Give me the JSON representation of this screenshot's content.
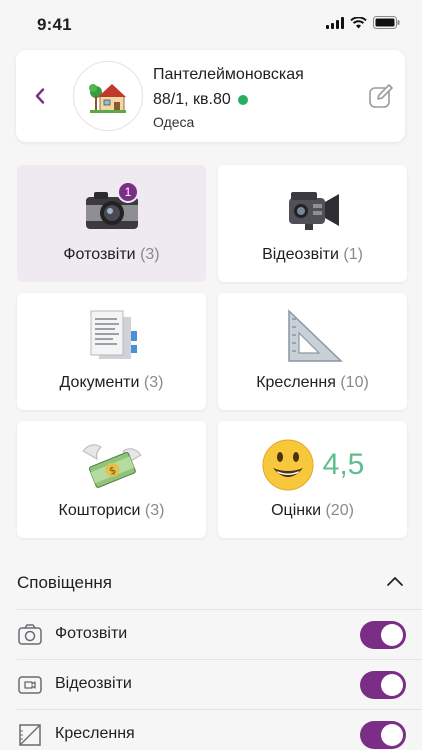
{
  "status_bar": {
    "time": "9:41"
  },
  "header": {
    "street": "Пантелеймоновская",
    "house": "88/1, кв.80",
    "city": "Одеса",
    "status_color": "#27ae60"
  },
  "tiles": [
    {
      "label": "Фотозвіти",
      "count": "(3)",
      "badge": "1",
      "icon": "camera-icon",
      "active": true
    },
    {
      "label": "Відеозвіти",
      "count": "(1)",
      "icon": "video-camera-icon"
    },
    {
      "label": "Документи",
      "count": "(3)",
      "icon": "documents-icon"
    },
    {
      "label": "Креслення",
      "count": "(10)",
      "icon": "triangle-ruler-icon"
    },
    {
      "label": "Кошториси",
      "count": "(3)",
      "icon": "money-with-wings-icon"
    },
    {
      "label": "Оцінки",
      "count": "(20)",
      "icon": "smiley-icon",
      "rating": "4,5"
    }
  ],
  "notifications": {
    "title": "Сповіщення",
    "items": [
      {
        "label": "Фотозвіти",
        "icon": "camera-outline-icon",
        "enabled": true
      },
      {
        "label": "Відеозвіти",
        "icon": "video-outline-icon",
        "enabled": true
      },
      {
        "label": "Креслення",
        "icon": "drawing-outline-icon",
        "enabled": true
      }
    ]
  },
  "colors": {
    "accent": "#7b2e86",
    "rating": "#5fbf8c",
    "active_tile": "#efe9f2"
  }
}
